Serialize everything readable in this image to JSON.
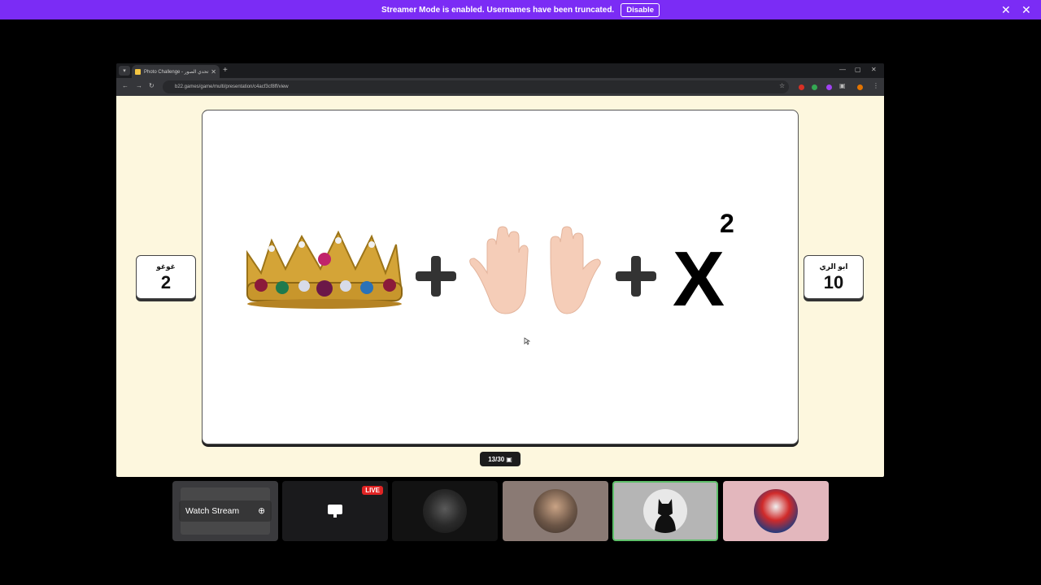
{
  "banner": {
    "message": "Streamer Mode is enabled. Usernames have been truncated.",
    "disable_label": "Disable"
  },
  "browser": {
    "tab_title": "Photo Challenge - تحدي الصور",
    "url": "b22.games/game/multi/presentation/c4acf3cf8ff/view"
  },
  "game": {
    "left_player": {
      "name": "غوغو",
      "score": "2"
    },
    "right_player": {
      "name": "ابو الري",
      "score": "10"
    },
    "superscript": "2",
    "big_letter": "X",
    "counter": "13/30"
  },
  "call": {
    "watch_stream_label": "Watch Stream",
    "live_label": "LIVE"
  },
  "colors": {
    "banner": "#7b2cf5",
    "page_bg": "#fdf7de",
    "active_border": "#5fc06b"
  }
}
